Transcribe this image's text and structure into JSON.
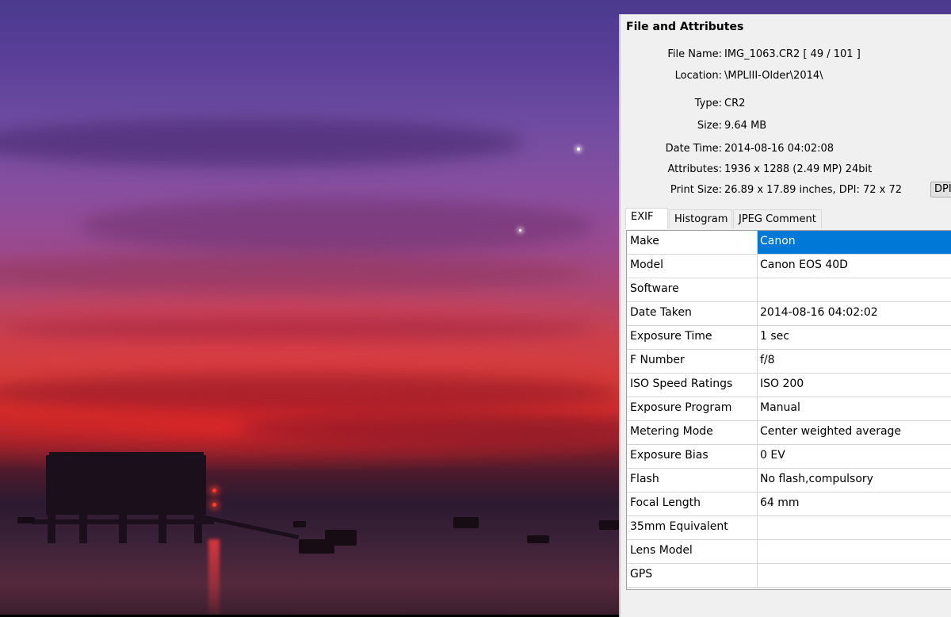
{
  "panel": {
    "title": "File and Attributes",
    "info": [
      {
        "label": "File Name:",
        "value": "IMG_1063.CR2   [ 49 / 101 ]"
      },
      {
        "label": "Location:",
        "value": "\\MPLIII-Older\\2014\\"
      },
      {
        "label": "Type:",
        "value": "CR2"
      },
      {
        "label": "Size:",
        "value": "9.64 MB"
      },
      {
        "label": "Date Time:",
        "value": "2014-08-16 04:02:08"
      },
      {
        "label": "Attributes:",
        "value": "1936 x 1288 (2.49 MP)  24bit"
      },
      {
        "label": "Print Size:",
        "value": "26.89 x 17.89 inches,  DPI: 72 x 72"
      }
    ],
    "dpi_button_label": "DPI"
  },
  "tabs": [
    {
      "label": "EXIF",
      "active": true
    },
    {
      "label": "Histogram",
      "active": false
    },
    {
      "label": "JPEG Comment",
      "active": false
    }
  ],
  "exif": [
    {
      "key": "Make",
      "value": "Canon",
      "selected": true
    },
    {
      "key": "Model",
      "value": "Canon EOS 40D"
    },
    {
      "key": "Software",
      "value": ""
    },
    {
      "key": "Date Taken",
      "value": "2014-08-16 04:02:02"
    },
    {
      "key": "Exposure Time",
      "value": "1 sec"
    },
    {
      "key": "F Number",
      "value": "f/8"
    },
    {
      "key": "ISO Speed Ratings",
      "value": "ISO 200"
    },
    {
      "key": "Exposure Program",
      "value": "Manual"
    },
    {
      "key": "Metering Mode",
      "value": "Center weighted average"
    },
    {
      "key": "Exposure Bias",
      "value": "0 EV"
    },
    {
      "key": "Flash",
      "value": "No flash,compulsory"
    },
    {
      "key": "Focal Length",
      "value": "64 mm"
    },
    {
      "key": "35mm Equivalent",
      "value": ""
    },
    {
      "key": "Lens Model",
      "value": ""
    },
    {
      "key": "GPS",
      "value": ""
    }
  ],
  "colors": {
    "selection": "#0078d7",
    "panel_bg": "#f0f0f0"
  }
}
